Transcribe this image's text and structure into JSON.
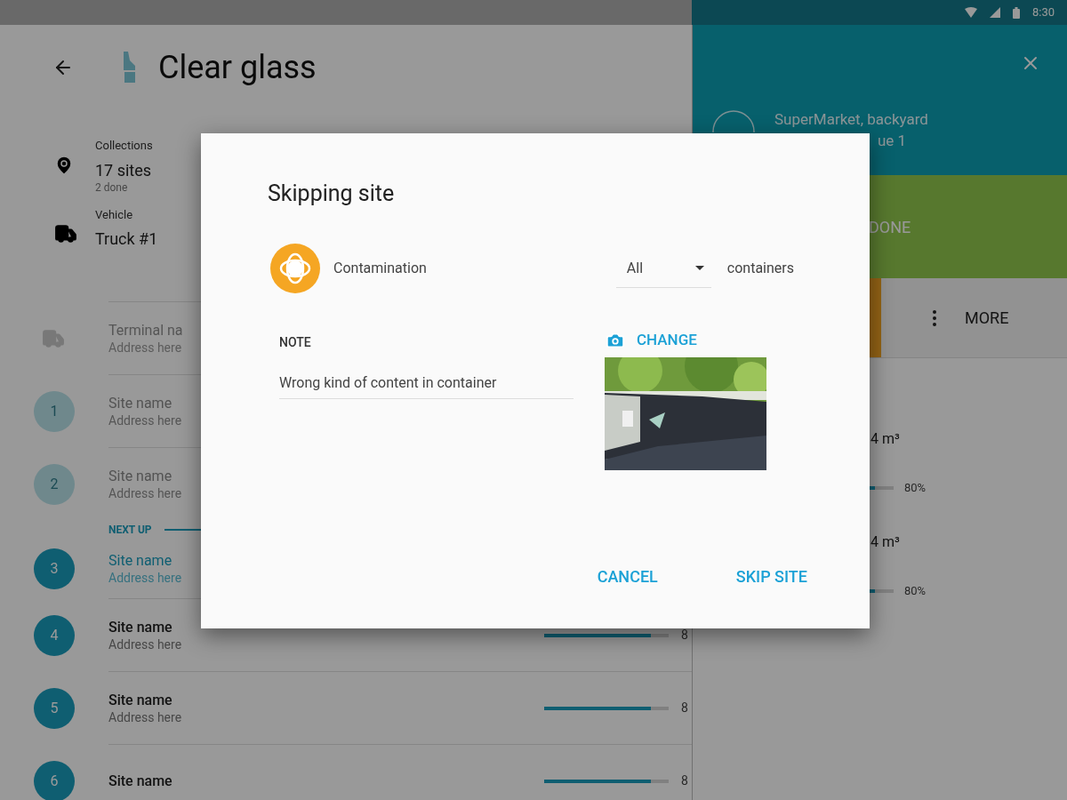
{
  "status_bar": {
    "time": "8:30"
  },
  "header": {
    "title": "Clear glass"
  },
  "summary": [
    {
      "kind": "collections",
      "label": "Collections",
      "value": "17 sites",
      "detail": "2 done"
    },
    {
      "kind": "vehicle",
      "label": "Vehicle",
      "value": "Truck #1"
    }
  ],
  "terminal": {
    "name": "Terminal na",
    "address": "Address here"
  },
  "next_up_label": "NEXT UP",
  "sites": [
    {
      "number": "1",
      "name": "Site name",
      "address": "Address here",
      "done": true,
      "next_up": false
    },
    {
      "number": "2",
      "name": "Site name",
      "address": "Address here",
      "done": true,
      "next_up": false
    },
    {
      "number": "3",
      "name": "Site name",
      "address": "Address here",
      "done": false,
      "next_up": true
    },
    {
      "number": "4",
      "name": "Site name",
      "address": "Address here",
      "done": false,
      "next_up": false,
      "level": 0.86,
      "reading": "8"
    },
    {
      "number": "5",
      "name": "Site name",
      "address": "Address here",
      "done": false,
      "next_up": false,
      "level": 0.86,
      "reading": "8"
    },
    {
      "number": "6",
      "name": "Site name",
      "done": false,
      "next_up": false,
      "level": 0.86,
      "reading": "8"
    }
  ],
  "stop_panel": {
    "name": "SuperMarket, backyard",
    "address": "ue 1",
    "done_label": "DONE",
    "more_label": "MORE",
    "containers": [
      {
        "volume": "4 m³",
        "level": 0.8,
        "reading": "80%"
      },
      {
        "volume": "4 m³",
        "level": 0.8,
        "reading": "80%"
      }
    ]
  },
  "dialog": {
    "title": "Skipping site",
    "reason": "Contamination",
    "scope": {
      "value": "All",
      "suffix": "containers"
    },
    "note": {
      "label": "NOTE",
      "value": "Wrong kind of content in container"
    },
    "photo": {
      "action": "CHANGE",
      "kind": "picture"
    },
    "buttons": [
      "CANCEL",
      "SKIP SITE"
    ]
  }
}
